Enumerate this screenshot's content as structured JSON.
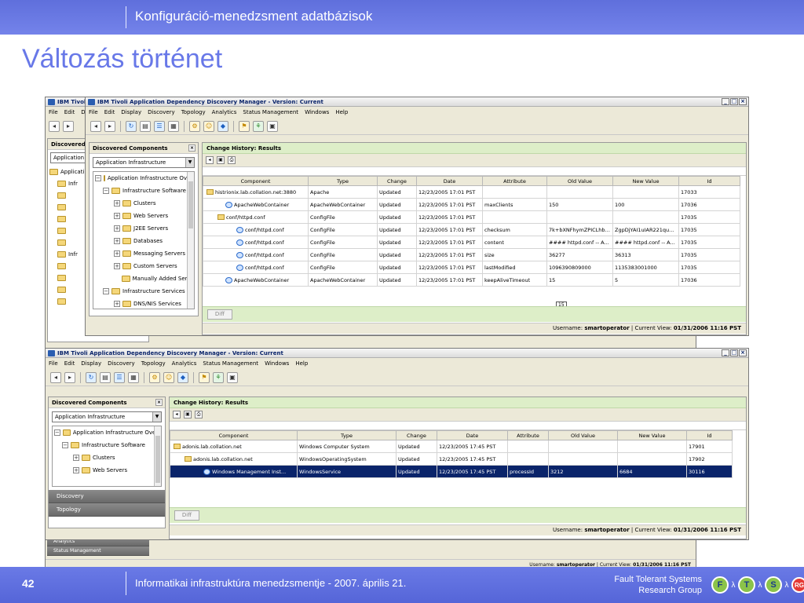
{
  "header": {
    "section": "Konfiguráció-menedzsment adatbázisok"
  },
  "slide": {
    "title": "Változás történet"
  },
  "footer": {
    "page": "42",
    "text": "Informatikai infrastruktúra menedzsmentje - 2007. április 21.",
    "org_line1": "Fault Tolerant Systems",
    "org_line2": "Research Group"
  },
  "logo": {
    "letters": [
      "F",
      "T",
      "S"
    ],
    "greek": [
      "λ",
      "μ",
      "λ",
      "μ",
      "λ",
      "μ"
    ],
    "badge": "RG"
  },
  "menu": [
    "File",
    "Edit",
    "Display",
    "Discovery",
    "Topology",
    "Analytics",
    "Status Management",
    "Windows",
    "Help"
  ],
  "back_window": {
    "title": "IBM Tivoli A",
    "menu": [
      "File",
      "Edit",
      "Disc"
    ],
    "pane_title": "Discovered Co",
    "select": "Application Infr",
    "tree": [
      "Applicati",
      "Infr",
      "",
      "",
      "",
      "",
      "",
      "Infr",
      "",
      "",
      "",
      ""
    ],
    "nav": [
      "Analytics",
      "Status Management"
    ],
    "status": {
      "user_label": "Username:",
      "user": "smartoperator",
      "view_label": "Current View:",
      "view": "01/31/2006 11:16 PST"
    }
  },
  "window1": {
    "title": "IBM Tivoli Application Dependency Discovery Manager - Version: Current",
    "pane_title": "Discovered Components",
    "select": "Application Infrastructure",
    "tree": [
      {
        "label": "Application Infrastructure Ove...",
        "exp": "−"
      },
      {
        "label": "Infrastructure Software",
        "exp": "−"
      },
      {
        "label": "Clusters",
        "exp": "+"
      },
      {
        "label": "Web Servers",
        "exp": "+"
      },
      {
        "label": "J2EE Servers",
        "exp": "+"
      },
      {
        "label": "Databases",
        "exp": "+"
      },
      {
        "label": "Messaging Servers",
        "exp": "+"
      },
      {
        "label": "Custom Servers",
        "exp": "+"
      },
      {
        "label": "Manually Added Serve",
        "exp": ""
      },
      {
        "label": "Infrastructure Services",
        "exp": "−"
      },
      {
        "label": "DNS/NIS Services",
        "exp": "+"
      }
    ],
    "results_title": "Change History: Results",
    "columns": [
      "Component",
      "Type",
      "Change",
      "Date",
      "Attribute",
      "Old Value",
      "New Value",
      "Id"
    ],
    "rows": [
      [
        "histrionix.lab.collation.net:3880",
        "Apache",
        "Updated",
        "12/23/2005 17:01 PST",
        "",
        "",
        "",
        "17033"
      ],
      [
        "ApacheWebContainer",
        "ApacheWebContainer",
        "Updated",
        "12/23/2005 17:01 PST",
        "maxClients",
        "150",
        "100",
        "17036"
      ],
      [
        "conf/httpd.conf",
        "ConfigFile",
        "Updated",
        "12/23/2005 17:01 PST",
        "",
        "",
        "",
        "17035"
      ],
      [
        "conf/httpd.conf",
        "ConfigFile",
        "Updated",
        "12/23/2005 17:01 PST",
        "checksum",
        "7k+bXNFhymZPICLhb6...",
        "ZgpDjYAI1uIAR221qu...",
        "17035"
      ],
      [
        "conf/httpd.conf",
        "ConfigFile",
        "Updated",
        "12/23/2005 17:01 PST",
        "content",
        "#### httpd.conf -- A...",
        "#### httpd.conf -- A...",
        "17035"
      ],
      [
        "conf/httpd.conf",
        "ConfigFile",
        "Updated",
        "12/23/2005 17:01 PST",
        "size",
        "36277",
        "36313",
        "17035"
      ],
      [
        "conf/httpd.conf",
        "ConfigFile",
        "Updated",
        "12/23/2005 17:01 PST",
        "lastModified",
        "1096390809000",
        "1135383001000",
        "17035"
      ],
      [
        "ApacheWebContainer",
        "ApacheWebContainer",
        "Updated",
        "12/23/2005 17:01 PST",
        "keepAliveTimeout",
        "15",
        "5",
        "17036"
      ]
    ],
    "badge": "15",
    "diff": "Diff",
    "status": {
      "user_label": "Username:",
      "user": "smartoperator",
      "view_label": "Current View:",
      "view": "01/31/2006 11:16 PST"
    }
  },
  "window2": {
    "title": "IBM Tivoli Application Dependency Discovery Manager - Version: Current",
    "pane_title": "Discovered Components",
    "select": "Application Infrastructure",
    "tree": [
      {
        "label": "Application Infrastructure Ove...",
        "exp": "−"
      },
      {
        "label": "Infrastructure Software",
        "exp": "−"
      },
      {
        "label": "Clusters",
        "exp": "+"
      },
      {
        "label": "Web Servers",
        "exp": "+"
      }
    ],
    "nav": [
      "Discovery",
      "Topology"
    ],
    "results_title": "Change History: Results",
    "columns": [
      "Component",
      "Type",
      "Change",
      "Date",
      "Attribute",
      "Old Value",
      "New Value",
      "Id"
    ],
    "rows": [
      [
        "adonis.lab.collation.net",
        "Windows Computer System",
        "Updated",
        "12/23/2005 17:45 PST",
        "",
        "",
        "",
        "17901"
      ],
      [
        "adonis.lab.collation.net",
        "WindowsOperatingSystem",
        "Updated",
        "12/23/2005 17:45 PST",
        "",
        "",
        "",
        "17902"
      ],
      [
        "Windows Management Inst...",
        "WindowsService",
        "Updated",
        "12/23/2005 17:45 PST",
        "processId",
        "3212",
        "6684",
        "30116"
      ]
    ],
    "diff": "Diff",
    "status": {
      "user_label": "Username:",
      "user": "smartoperator",
      "view_label": "Current View:",
      "view": "01/31/2006 11:16 PST"
    }
  }
}
